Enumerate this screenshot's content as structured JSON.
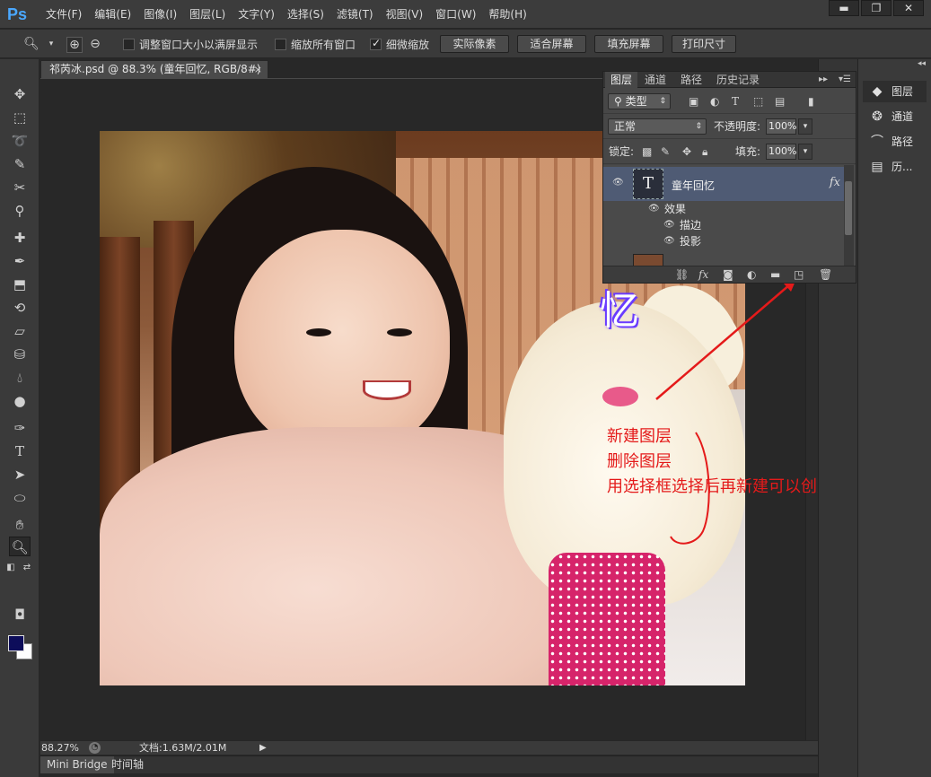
{
  "app": {
    "logo": "Ps",
    "menu": [
      "文件(F)",
      "编辑(E)",
      "图像(I)",
      "图层(L)",
      "文字(Y)",
      "选择(S)",
      "滤镜(T)",
      "视图(V)",
      "窗口(W)",
      "帮助(H)"
    ],
    "window_buttons": [
      "▬",
      "❐",
      "✕"
    ]
  },
  "options_bar": {
    "check_resize": {
      "label": "调整窗口大小以满屏显示",
      "checked": false
    },
    "check_zoom_all": {
      "label": "缩放所有窗口",
      "checked": false
    },
    "check_scrubby": {
      "label": "细微缩放",
      "checked": true
    },
    "btn_actual": "实际像素",
    "btn_fit": "适合屏幕",
    "btn_fill": "填充屏幕",
    "btn_print": "打印尺寸"
  },
  "document": {
    "tab_title": "祁芮冰.psd @ 88.3% (童年回忆, RGB/8#)",
    "close": "×",
    "overlay_char": "忆"
  },
  "annotations": [
    "新建图层",
    "删除图层",
    "用选择框选择后再新建可以创建新图层"
  ],
  "status": {
    "zoom": "88.27%",
    "doc_info": "文档:1.63M/2.01M",
    "arrow": "▶"
  },
  "bottom_tabs": [
    "Mini Bridge",
    "时间轴"
  ],
  "layers_panel": {
    "tabs": [
      "图层",
      "通道",
      "路径",
      "历史记录"
    ],
    "filter_label": "类型",
    "blend_mode": "正常",
    "opacity_label": "不透明度:",
    "opacity_value": "100%",
    "lock_label": "锁定:",
    "fill_label": "填充:",
    "fill_value": "100%",
    "layer_name": "童年回忆",
    "layer_thumb": "T",
    "fx_label": "fx",
    "effects_label": "效果",
    "effect_1": "描边",
    "effect_2": "投影"
  },
  "dock": {
    "items": [
      {
        "label": "图层",
        "icon": "layers-icon",
        "glyph": "◆"
      },
      {
        "label": "通道",
        "icon": "channels-icon",
        "glyph": "❂"
      },
      {
        "label": "路径",
        "icon": "paths-icon",
        "glyph": "⌒"
      },
      {
        "label": "历...",
        "icon": "history-icon",
        "glyph": "▤"
      }
    ]
  },
  "colors": {
    "foreground": "#0d0d5a",
    "background": "#ffffff",
    "annotation": "#e41a1a",
    "selected_layer": "#4f5b74"
  }
}
